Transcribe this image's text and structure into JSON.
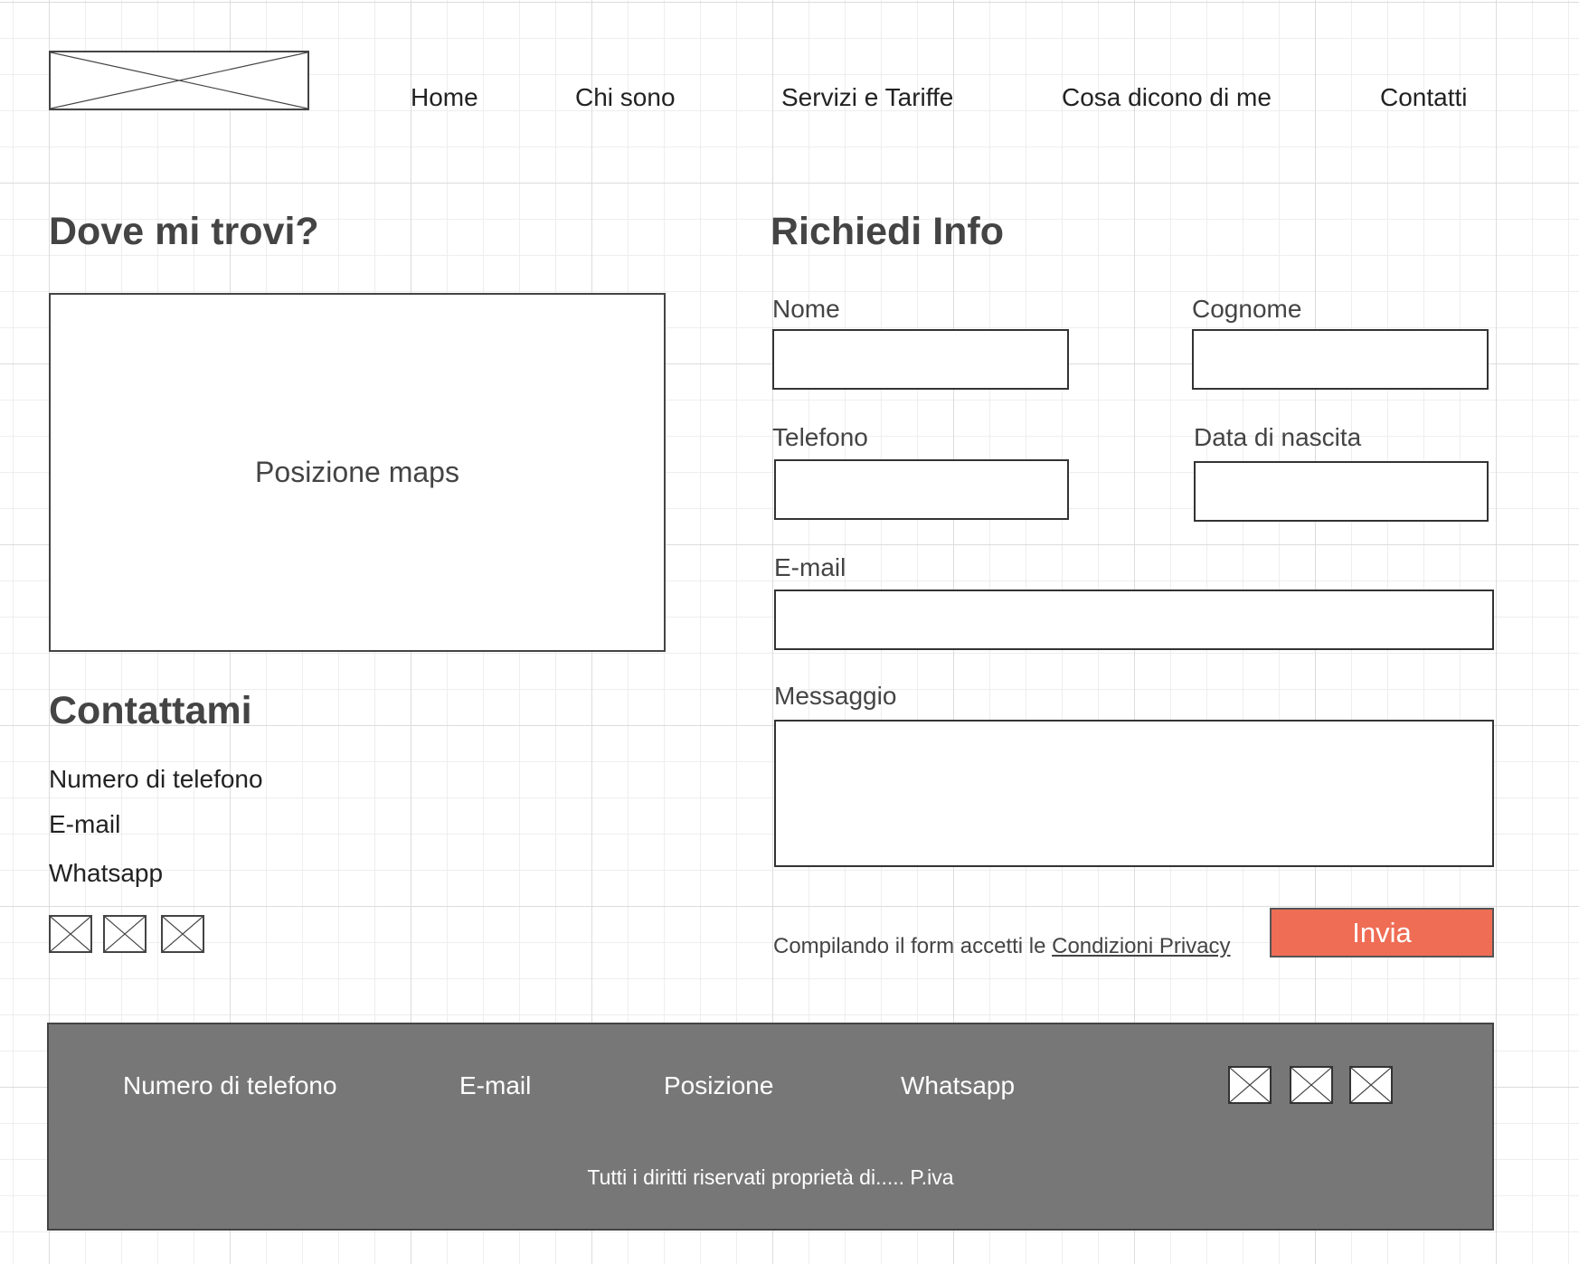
{
  "header": {
    "logo_icon": "image-placeholder-icon",
    "nav": [
      {
        "label": "Home"
      },
      {
        "label": "Chi sono"
      },
      {
        "label": "Servizi e Tariffe"
      },
      {
        "label": "Cosa dicono di me"
      },
      {
        "label": "Contatti"
      }
    ]
  },
  "location": {
    "title": "Dove mi trovi?",
    "map_label": "Posizione maps"
  },
  "contact": {
    "title": "Contattami",
    "phone": "Numero di telefono",
    "email": "E-mail",
    "whatsapp": "Whatsapp",
    "social_icons": [
      "image-placeholder-icon",
      "image-placeholder-icon",
      "image-placeholder-icon"
    ]
  },
  "form": {
    "title": "Richiedi Info",
    "fields": {
      "nome": {
        "label": "Nome",
        "value": ""
      },
      "cognome": {
        "label": "Cognome",
        "value": ""
      },
      "telefono": {
        "label": "Telefono",
        "value": ""
      },
      "data_nascita": {
        "label": "Data di nascita",
        "value": ""
      },
      "email": {
        "label": "E-mail",
        "value": ""
      },
      "messaggio": {
        "label": "Messaggio",
        "value": ""
      }
    },
    "privacy_prefix": "Compilando il form accetti le",
    "privacy_link": "Condizioni Privacy",
    "submit_label": "Invia"
  },
  "footer": {
    "items": [
      {
        "label": "Numero di telefono"
      },
      {
        "label": "E-mail"
      },
      {
        "label": "Posizione"
      },
      {
        "label": "Whatsapp"
      }
    ],
    "social_icons": [
      "image-placeholder-icon",
      "image-placeholder-icon",
      "image-placeholder-icon"
    ],
    "copyright": "Tutti i diritti riservati proprietà di..... P.iva"
  },
  "colors": {
    "accent": "#ef6d55",
    "footer_bg": "#777777",
    "border": "#444444"
  }
}
